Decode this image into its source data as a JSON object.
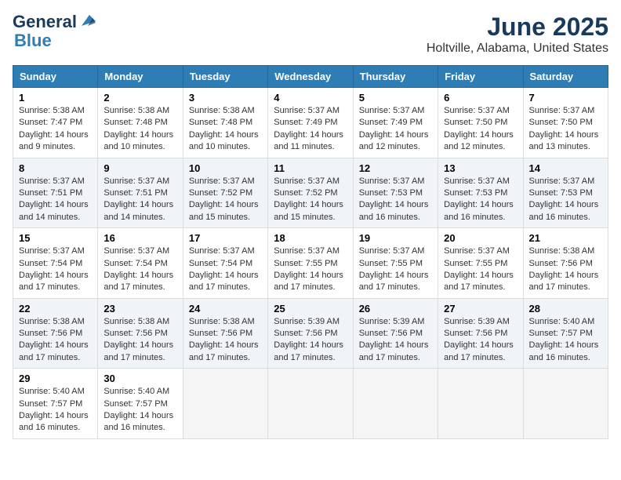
{
  "header": {
    "logo_general": "General",
    "logo_blue": "Blue",
    "month": "June 2025",
    "location": "Holtville, Alabama, United States"
  },
  "days_of_week": [
    "Sunday",
    "Monday",
    "Tuesday",
    "Wednesday",
    "Thursday",
    "Friday",
    "Saturday"
  ],
  "weeks": [
    [
      {
        "day": "1",
        "info": "Sunrise: 5:38 AM\nSunset: 7:47 PM\nDaylight: 14 hours\nand 9 minutes."
      },
      {
        "day": "2",
        "info": "Sunrise: 5:38 AM\nSunset: 7:48 PM\nDaylight: 14 hours\nand 10 minutes."
      },
      {
        "day": "3",
        "info": "Sunrise: 5:38 AM\nSunset: 7:48 PM\nDaylight: 14 hours\nand 10 minutes."
      },
      {
        "day": "4",
        "info": "Sunrise: 5:37 AM\nSunset: 7:49 PM\nDaylight: 14 hours\nand 11 minutes."
      },
      {
        "day": "5",
        "info": "Sunrise: 5:37 AM\nSunset: 7:49 PM\nDaylight: 14 hours\nand 12 minutes."
      },
      {
        "day": "6",
        "info": "Sunrise: 5:37 AM\nSunset: 7:50 PM\nDaylight: 14 hours\nand 12 minutes."
      },
      {
        "day": "7",
        "info": "Sunrise: 5:37 AM\nSunset: 7:50 PM\nDaylight: 14 hours\nand 13 minutes."
      }
    ],
    [
      {
        "day": "8",
        "info": "Sunrise: 5:37 AM\nSunset: 7:51 PM\nDaylight: 14 hours\nand 14 minutes."
      },
      {
        "day": "9",
        "info": "Sunrise: 5:37 AM\nSunset: 7:51 PM\nDaylight: 14 hours\nand 14 minutes."
      },
      {
        "day": "10",
        "info": "Sunrise: 5:37 AM\nSunset: 7:52 PM\nDaylight: 14 hours\nand 15 minutes."
      },
      {
        "day": "11",
        "info": "Sunrise: 5:37 AM\nSunset: 7:52 PM\nDaylight: 14 hours\nand 15 minutes."
      },
      {
        "day": "12",
        "info": "Sunrise: 5:37 AM\nSunset: 7:53 PM\nDaylight: 14 hours\nand 16 minutes."
      },
      {
        "day": "13",
        "info": "Sunrise: 5:37 AM\nSunset: 7:53 PM\nDaylight: 14 hours\nand 16 minutes."
      },
      {
        "day": "14",
        "info": "Sunrise: 5:37 AM\nSunset: 7:53 PM\nDaylight: 14 hours\nand 16 minutes."
      }
    ],
    [
      {
        "day": "15",
        "info": "Sunrise: 5:37 AM\nSunset: 7:54 PM\nDaylight: 14 hours\nand 17 minutes."
      },
      {
        "day": "16",
        "info": "Sunrise: 5:37 AM\nSunset: 7:54 PM\nDaylight: 14 hours\nand 17 minutes."
      },
      {
        "day": "17",
        "info": "Sunrise: 5:37 AM\nSunset: 7:54 PM\nDaylight: 14 hours\nand 17 minutes."
      },
      {
        "day": "18",
        "info": "Sunrise: 5:37 AM\nSunset: 7:55 PM\nDaylight: 14 hours\nand 17 minutes."
      },
      {
        "day": "19",
        "info": "Sunrise: 5:37 AM\nSunset: 7:55 PM\nDaylight: 14 hours\nand 17 minutes."
      },
      {
        "day": "20",
        "info": "Sunrise: 5:37 AM\nSunset: 7:55 PM\nDaylight: 14 hours\nand 17 minutes."
      },
      {
        "day": "21",
        "info": "Sunrise: 5:38 AM\nSunset: 7:56 PM\nDaylight: 14 hours\nand 17 minutes."
      }
    ],
    [
      {
        "day": "22",
        "info": "Sunrise: 5:38 AM\nSunset: 7:56 PM\nDaylight: 14 hours\nand 17 minutes."
      },
      {
        "day": "23",
        "info": "Sunrise: 5:38 AM\nSunset: 7:56 PM\nDaylight: 14 hours\nand 17 minutes."
      },
      {
        "day": "24",
        "info": "Sunrise: 5:38 AM\nSunset: 7:56 PM\nDaylight: 14 hours\nand 17 minutes."
      },
      {
        "day": "25",
        "info": "Sunrise: 5:39 AM\nSunset: 7:56 PM\nDaylight: 14 hours\nand 17 minutes."
      },
      {
        "day": "26",
        "info": "Sunrise: 5:39 AM\nSunset: 7:56 PM\nDaylight: 14 hours\nand 17 minutes."
      },
      {
        "day": "27",
        "info": "Sunrise: 5:39 AM\nSunset: 7:56 PM\nDaylight: 14 hours\nand 17 minutes."
      },
      {
        "day": "28",
        "info": "Sunrise: 5:40 AM\nSunset: 7:57 PM\nDaylight: 14 hours\nand 16 minutes."
      }
    ],
    [
      {
        "day": "29",
        "info": "Sunrise: 5:40 AM\nSunset: 7:57 PM\nDaylight: 14 hours\nand 16 minutes."
      },
      {
        "day": "30",
        "info": "Sunrise: 5:40 AM\nSunset: 7:57 PM\nDaylight: 14 hours\nand 16 minutes."
      },
      {
        "day": "",
        "info": ""
      },
      {
        "day": "",
        "info": ""
      },
      {
        "day": "",
        "info": ""
      },
      {
        "day": "",
        "info": ""
      },
      {
        "day": "",
        "info": ""
      }
    ]
  ]
}
